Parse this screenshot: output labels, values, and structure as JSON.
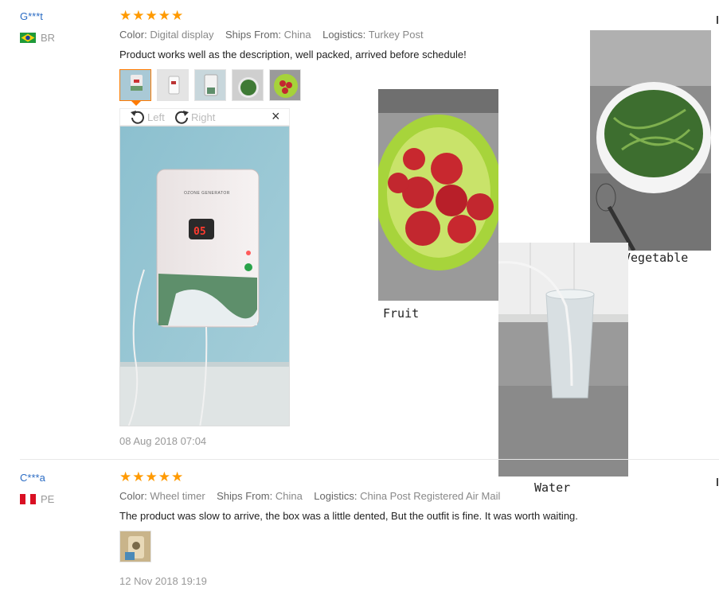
{
  "reviews": [
    {
      "user": "G***t",
      "country": "BR",
      "stars": "★★★★★",
      "color_key": "Color:",
      "color_val": "Digital display",
      "ships_key": "Ships From:",
      "ships_val": "China",
      "logistics_key": "Logistics:",
      "logistics_val": "Turkey Post",
      "text": "Product works well as the description, well packed, arrived before schedule!",
      "date": "08 Aug 2018 07:04"
    },
    {
      "user": "C***a",
      "country": "PE",
      "stars": "★★★★★",
      "color_key": "Color:",
      "color_val": "Wheel timer",
      "ships_key": "Ships From:",
      "ships_val": "China",
      "logistics_key": "Logistics:",
      "logistics_val": "China Post Registered Air Mail",
      "text": "The product was slow to arrive, the box was a little dented, But the outfit is fine. It was worth waiting.",
      "date": "12 Nov 2018 19:19"
    }
  ],
  "viewer": {
    "left_label": "Left",
    "right_label": "Right",
    "close": "×",
    "display_digits": "05",
    "device_label": "OZONE GENERATOR"
  },
  "collage": {
    "fruit": "Fruit",
    "vegetable": "Vegetable",
    "water": "Water"
  },
  "colors": {
    "star": "#ff9a00",
    "accent_border": "#ff7a00",
    "username": "#2b6cc4"
  }
}
